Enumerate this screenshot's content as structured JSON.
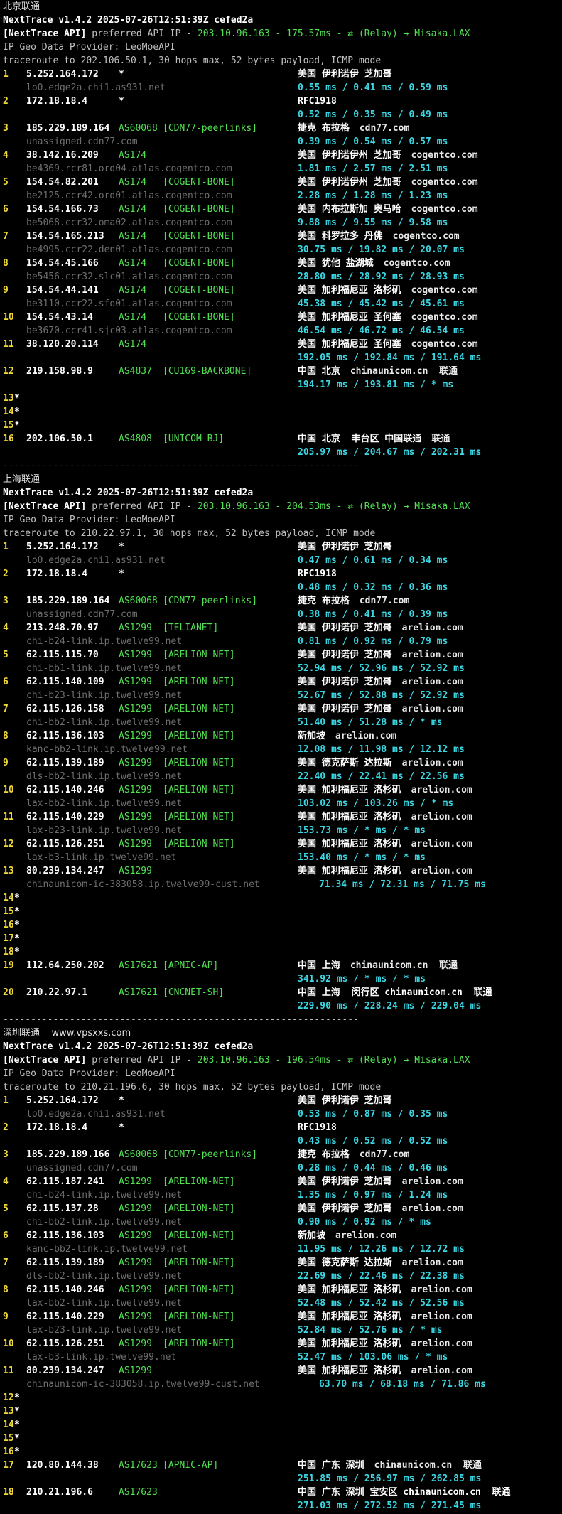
{
  "sections": [
    {
      "title": "北京联通",
      "version_line": "NextTrace v1.4.2 2025-07-26T12:51:39Z cefed2a",
      "api_prefix": "[NextTrace API]",
      "api_text": " preferred API IP - ",
      "api_value": "203.10.96.163 - 175.57ms - ",
      "api_relay_icon": "relay-icon",
      "api_relay": " (Relay) → Misaka.LAX",
      "geo_provider": "IP Geo Data Provider: LeoMoeAPI",
      "trace_info": "traceroute to 202.106.50.1, 30 hops max, 52 bytes payload, ICMP mode",
      "hops": [
        {
          "n": "1",
          "ip": "5.252.164.172",
          "asn": "*",
          "tag": "",
          "geo": "美国 伊利诺伊 芝加哥",
          "domain": "",
          "rdns": "lo0.edge2a.chi1.as931.net",
          "rtt": "0.55 ms / 0.41 ms / 0.59 ms"
        },
        {
          "n": "2",
          "ip": "172.18.18.4",
          "asn": "*",
          "tag": "",
          "geo": "RFC1918",
          "domain": "",
          "rdns": "",
          "rtt": "0.52 ms / 0.35 ms / 0.49 ms"
        },
        {
          "n": "3",
          "ip": "185.229.189.164",
          "asn": "AS60068",
          "tag": "[CDN77-peerlinks]",
          "geo": "捷克 布拉格",
          "domain": "cdn77.com",
          "rdns": "unassigned.cdn77.com",
          "rtt": "0.39 ms / 0.54 ms / 0.57 ms"
        },
        {
          "n": "4",
          "ip": "38.142.16.209",
          "asn": "AS174",
          "tag": "",
          "geo": "美国 伊利诺伊州 芝加哥",
          "domain": "cogentco.com",
          "rdns": "be4369.rcr81.ord04.atlas.cogentco.com",
          "rtt": "1.81 ms / 2.57 ms / 2.51 ms"
        },
        {
          "n": "5",
          "ip": "154.54.82.201",
          "asn": "AS174",
          "tag": "[COGENT-BONE]",
          "geo": "美国 伊利诺伊州 芝加哥",
          "domain": "cogentco.com",
          "rdns": "be2125.ccr42.ord01.atlas.cogentco.com",
          "rtt": "2.28 ms / 1.28 ms / 1.23 ms"
        },
        {
          "n": "6",
          "ip": "154.54.166.73",
          "asn": "AS174",
          "tag": "[COGENT-BONE]",
          "geo": "美国 内布拉斯加 奥马哈",
          "domain": "cogentco.com",
          "rdns": "be5068.ccr32.oma02.atlas.cogentco.com",
          "rtt": "9.88 ms / 9.55 ms / 9.58 ms"
        },
        {
          "n": "7",
          "ip": "154.54.165.213",
          "asn": "AS174",
          "tag": "[COGENT-BONE]",
          "geo": "美国 科罗拉多 丹佛",
          "domain": "cogentco.com",
          "rdns": "be4995.ccr22.den01.atlas.cogentco.com",
          "rtt": "30.75 ms / 19.82 ms / 20.07 ms"
        },
        {
          "n": "8",
          "ip": "154.54.45.166",
          "asn": "AS174",
          "tag": "[COGENT-BONE]",
          "geo": "美国 犹他 盐湖城",
          "domain": "cogentco.com",
          "rdns": "be5456.ccr32.slc01.atlas.cogentco.com",
          "rtt": "28.80 ms / 28.92 ms / 28.93 ms"
        },
        {
          "n": "9",
          "ip": "154.54.44.141",
          "asn": "AS174",
          "tag": "[COGENT-BONE]",
          "geo": "美国 加利福尼亚 洛杉矶",
          "domain": "cogentco.com",
          "rdns": "be3110.ccr22.sfo01.atlas.cogentco.com",
          "rtt": "45.38 ms / 45.42 ms / 45.61 ms"
        },
        {
          "n": "10",
          "ip": "154.54.43.14",
          "asn": "AS174",
          "tag": "[COGENT-BONE]",
          "geo": "美国 加利福尼亚 圣何塞",
          "domain": "cogentco.com",
          "rdns": "be3670.ccr41.sjc03.atlas.cogentco.com",
          "rtt": "46.54 ms / 46.72 ms / 46.54 ms"
        },
        {
          "n": "11",
          "ip": "38.120.20.114",
          "asn": "AS174",
          "tag": "",
          "geo": "美国 加利福尼亚 圣何塞",
          "domain": "cogentco.com",
          "rdns": "",
          "rtt": "192.05 ms / 192.84 ms / 191.64 ms"
        },
        {
          "n": "12",
          "ip": "219.158.98.9",
          "asn": "AS4837",
          "tag": "[CU169-BACKBONE]",
          "geo": "中国 北京",
          "domain": "chinaunicom.cn  联通",
          "rdns": "",
          "rtt": "194.17 ms / 193.81 ms / * ms"
        },
        {
          "n": "13",
          "star": "*"
        },
        {
          "n": "14",
          "star": "*"
        },
        {
          "n": "15",
          "star": "*"
        },
        {
          "n": "16",
          "ip": "202.106.50.1",
          "asn": "AS4808",
          "tag": "[UNICOM-BJ]",
          "geo": "中国 北京  丰台区 中国联通",
          "domain": "联通",
          "rdns": "",
          "rtt": "205.97 ms / 204.67 ms / 202.31 ms"
        }
      ]
    },
    {
      "title": "上海联通",
      "version_line": "NextTrace v1.4.2 2025-07-26T12:51:39Z cefed2a",
      "api_prefix": "[NextTrace API]",
      "api_text": " preferred API IP - ",
      "api_value": "203.10.96.163 - 204.53ms - ",
      "api_relay_icon": "relay-icon",
      "api_relay": " (Relay) → Misaka.LAX",
      "geo_provider": "IP Geo Data Provider: LeoMoeAPI",
      "trace_info": "traceroute to 210.22.97.1, 30 hops max, 52 bytes payload, ICMP mode",
      "hops": [
        {
          "n": "1",
          "ip": "5.252.164.172",
          "asn": "*",
          "tag": "",
          "geo": "美国 伊利诺伊 芝加哥",
          "domain": "",
          "rdns": "lo0.edge2a.chi1.as931.net",
          "rtt": "0.47 ms / 0.61 ms / 0.34 ms"
        },
        {
          "n": "2",
          "ip": "172.18.18.4",
          "asn": "*",
          "tag": "",
          "geo": "RFC1918",
          "domain": "",
          "rdns": "",
          "rtt": "0.48 ms / 0.32 ms / 0.36 ms"
        },
        {
          "n": "3",
          "ip": "185.229.189.164",
          "asn": "AS60068",
          "tag": "[CDN77-peerlinks]",
          "geo": "捷克 布拉格",
          "domain": "cdn77.com",
          "rdns": "unassigned.cdn77.com",
          "rtt": "0.38 ms / 0.41 ms / 0.39 ms"
        },
        {
          "n": "4",
          "ip": "213.248.70.97",
          "asn": "AS1299",
          "tag": "[TELIANET]",
          "geo": "美国 伊利诺伊 芝加哥",
          "domain": "arelion.com",
          "rdns": "chi-b24-link.ip.twelve99.net",
          "rtt": "0.81 ms / 0.92 ms / 0.79 ms"
        },
        {
          "n": "5",
          "ip": "62.115.115.70",
          "asn": "AS1299",
          "tag": "[ARELION-NET]",
          "geo": "美国 伊利诺伊 芝加哥",
          "domain": "arelion.com",
          "rdns": "chi-bb1-link.ip.twelve99.net",
          "rtt": "52.94 ms / 52.96 ms / 52.92 ms"
        },
        {
          "n": "6",
          "ip": "62.115.140.109",
          "asn": "AS1299",
          "tag": "[ARELION-NET]",
          "geo": "美国 伊利诺伊 芝加哥",
          "domain": "arelion.com",
          "rdns": "chi-b23-link.ip.twelve99.net",
          "rtt": "52.67 ms / 52.88 ms / 52.92 ms"
        },
        {
          "n": "7",
          "ip": "62.115.126.158",
          "asn": "AS1299",
          "tag": "[ARELION-NET]",
          "geo": "美国 伊利诺伊 芝加哥",
          "domain": "arelion.com",
          "rdns": "chi-bb2-link.ip.twelve99.net",
          "rtt": "51.40 ms / 51.28 ms / * ms"
        },
        {
          "n": "8",
          "ip": "62.115.136.103",
          "asn": "AS1299",
          "tag": "[ARELION-NET]",
          "geo": "新加坡",
          "domain": "arelion.com",
          "rdns": "kanc-bb2-link.ip.twelve99.net",
          "rtt": "12.08 ms / 11.98 ms / 12.12 ms"
        },
        {
          "n": "9",
          "ip": "62.115.139.189",
          "asn": "AS1299",
          "tag": "[ARELION-NET]",
          "geo": "美国 德克萨斯 达拉斯",
          "domain": "arelion.com",
          "rdns": "dls-bb2-link.ip.twelve99.net",
          "rtt": "22.40 ms / 22.41 ms / 22.56 ms"
        },
        {
          "n": "10",
          "ip": "62.115.140.246",
          "asn": "AS1299",
          "tag": "[ARELION-NET]",
          "geo": "美国 加利福尼亚 洛杉矶",
          "domain": "arelion.com",
          "rdns": "lax-bb2-link.ip.twelve99.net",
          "rtt": "103.02 ms / 103.26 ms / * ms"
        },
        {
          "n": "11",
          "ip": "62.115.140.229",
          "asn": "AS1299",
          "tag": "[ARELION-NET]",
          "geo": "美国 加利福尼亚 洛杉矶",
          "domain": "arelion.com",
          "rdns": "lax-b23-link.ip.twelve99.net",
          "rtt": "153.73 ms / * ms / * ms"
        },
        {
          "n": "12",
          "ip": "62.115.126.251",
          "asn": "AS1299",
          "tag": "[ARELION-NET]",
          "geo": "美国 加利福尼亚 洛杉矶",
          "domain": "arelion.com",
          "rdns": "lax-b3-link.ip.twelve99.net",
          "rtt": "153.40 ms / * ms / * ms"
        },
        {
          "n": "13",
          "ip": "80.239.134.247",
          "asn": "AS1299",
          "tag": "",
          "geo": "美国 加利福尼亚 洛杉矶",
          "domain": "arelion.com",
          "rdns": "chinaunicom-ic-383058.ip.twelve99-cust.net",
          "rtt": "71.34 ms / 72.31 ms / 71.75 ms",
          "rtt_inline": true
        },
        {
          "n": "14",
          "star": "*"
        },
        {
          "n": "15",
          "star": "*"
        },
        {
          "n": "16",
          "star": "*"
        },
        {
          "n": "17",
          "star": "*"
        },
        {
          "n": "18",
          "star": "*"
        },
        {
          "n": "19",
          "ip": "112.64.250.202",
          "asn": "AS17621",
          "tag": "[APNIC-AP]",
          "geo": "中国 上海",
          "domain": "chinaunicom.cn  联通",
          "rdns": "",
          "rtt": "341.92 ms / * ms / * ms"
        },
        {
          "n": "20",
          "ip": "210.22.97.1",
          "asn": "AS17621",
          "tag": "[CNCNET-SH]",
          "geo": "中国 上海  闵行区 chinaunicom.cn  联通",
          "domain": "",
          "rdns": "",
          "rtt": "229.90 ms / 228.24 ms / 229.04 ms"
        }
      ]
    },
    {
      "title": "深圳联通",
      "watermark": "www.vpsxxs.com",
      "version_line": "NextTrace v1.4.2 2025-07-26T12:51:39Z cefed2a",
      "api_prefix": "[NextTrace API]",
      "api_text": " preferred API IP - ",
      "api_value": "203.10.96.163 - 196.54ms - ",
      "api_relay_icon": "relay-icon",
      "api_relay": " (Relay) → Misaka.LAX",
      "geo_provider": "IP Geo Data Provider: LeoMoeAPI",
      "trace_info": "traceroute to 210.21.196.6, 30 hops max, 52 bytes payload, ICMP mode",
      "hops": [
        {
          "n": "1",
          "ip": "5.252.164.172",
          "asn": "*",
          "tag": "",
          "geo": "美国 伊利诺伊 芝加哥",
          "domain": "",
          "rdns": "lo0.edge2a.chi1.as931.net",
          "rtt": "0.53 ms / 0.87 ms / 0.35 ms"
        },
        {
          "n": "2",
          "ip": "172.18.18.4",
          "asn": "*",
          "tag": "",
          "geo": "RFC1918",
          "domain": "",
          "rdns": "",
          "rtt": "0.43 ms / 0.52 ms / 0.52 ms"
        },
        {
          "n": "3",
          "ip": "185.229.189.166",
          "asn": "AS60068",
          "tag": "[CDN77-peerlinks]",
          "geo": "捷克 布拉格",
          "domain": "cdn77.com",
          "rdns": "unassigned.cdn77.com",
          "rtt": "0.28 ms / 0.44 ms / 0.46 ms"
        },
        {
          "n": "4",
          "ip": "62.115.187.241",
          "asn": "AS1299",
          "tag": "[ARELION-NET]",
          "geo": "美国 伊利诺伊 芝加哥",
          "domain": "arelion.com",
          "rdns": "chi-b24-link.ip.twelve99.net",
          "rtt": "1.35 ms / 0.97 ms / 1.24 ms"
        },
        {
          "n": "5",
          "ip": "62.115.137.28",
          "asn": "AS1299",
          "tag": "[ARELION-NET]",
          "geo": "美国 伊利诺伊 芝加哥",
          "domain": "arelion.com",
          "rdns": "chi-bb2-link.ip.twelve99.net",
          "rtt": "0.90 ms / 0.92 ms / * ms"
        },
        {
          "n": "6",
          "ip": "62.115.136.103",
          "asn": "AS1299",
          "tag": "[ARELION-NET]",
          "geo": "新加坡",
          "domain": "arelion.com",
          "rdns": "kanc-bb2-link.ip.twelve99.net",
          "rtt": "11.95 ms / 12.26 ms / 12.72 ms"
        },
        {
          "n": "7",
          "ip": "62.115.139.189",
          "asn": "AS1299",
          "tag": "[ARELION-NET]",
          "geo": "美国 德克萨斯 达拉斯",
          "domain": "arelion.com",
          "rdns": "dls-bb2-link.ip.twelve99.net",
          "rtt": "22.69 ms / 22.46 ms / 22.38 ms"
        },
        {
          "n": "8",
          "ip": "62.115.140.246",
          "asn": "AS1299",
          "tag": "[ARELION-NET]",
          "geo": "美国 加利福尼亚 洛杉矶",
          "domain": "arelion.com",
          "rdns": "lax-bb2-link.ip.twelve99.net",
          "rtt": "52.48 ms / 52.42 ms / 52.56 ms"
        },
        {
          "n": "9",
          "ip": "62.115.140.229",
          "asn": "AS1299",
          "tag": "[ARELION-NET]",
          "geo": "美国 加利福尼亚 洛杉矶",
          "domain": "arelion.com",
          "rdns": "lax-b23-link.ip.twelve99.net",
          "rtt": "52.84 ms / 52.76 ms / * ms"
        },
        {
          "n": "10",
          "ip": "62.115.126.251",
          "asn": "AS1299",
          "tag": "[ARELION-NET]",
          "geo": "美国 加利福尼亚 洛杉矶",
          "domain": "arelion.com",
          "rdns": "lax-b3-link.ip.twelve99.net",
          "rtt": "52.47 ms / 103.06 ms / * ms"
        },
        {
          "n": "11",
          "ip": "80.239.134.247",
          "asn": "AS1299",
          "tag": "",
          "geo": "美国 加利福尼亚 洛杉矶",
          "domain": "arelion.com",
          "rdns": "chinaunicom-ic-383058.ip.twelve99-cust.net",
          "rtt": "63.70 ms / 68.18 ms / 71.86 ms",
          "rtt_inline": true
        },
        {
          "n": "12",
          "star": "*"
        },
        {
          "n": "13",
          "star": "*"
        },
        {
          "n": "14",
          "star": "*"
        },
        {
          "n": "15",
          "star": "*"
        },
        {
          "n": "16",
          "star": "*"
        },
        {
          "n": "17",
          "ip": "120.80.144.38",
          "asn": "AS17623",
          "tag": "[APNIC-AP]",
          "geo": "中国 广东 深圳",
          "domain": "chinaunicom.cn  联通",
          "rdns": "",
          "rtt": "251.85 ms / 256.97 ms / 262.85 ms"
        },
        {
          "n": "18",
          "ip": "210.21.196.6",
          "asn": "AS17623",
          "tag": "",
          "geo": "中国 广东 深圳 宝安区 chinaunicom.cn  联通",
          "domain": "",
          "rdns": "",
          "rtt": "271.03 ms / 272.52 ms / 271.45 ms"
        }
      ]
    }
  ],
  "separator": "----------------------------------------------------------------------------------"
}
